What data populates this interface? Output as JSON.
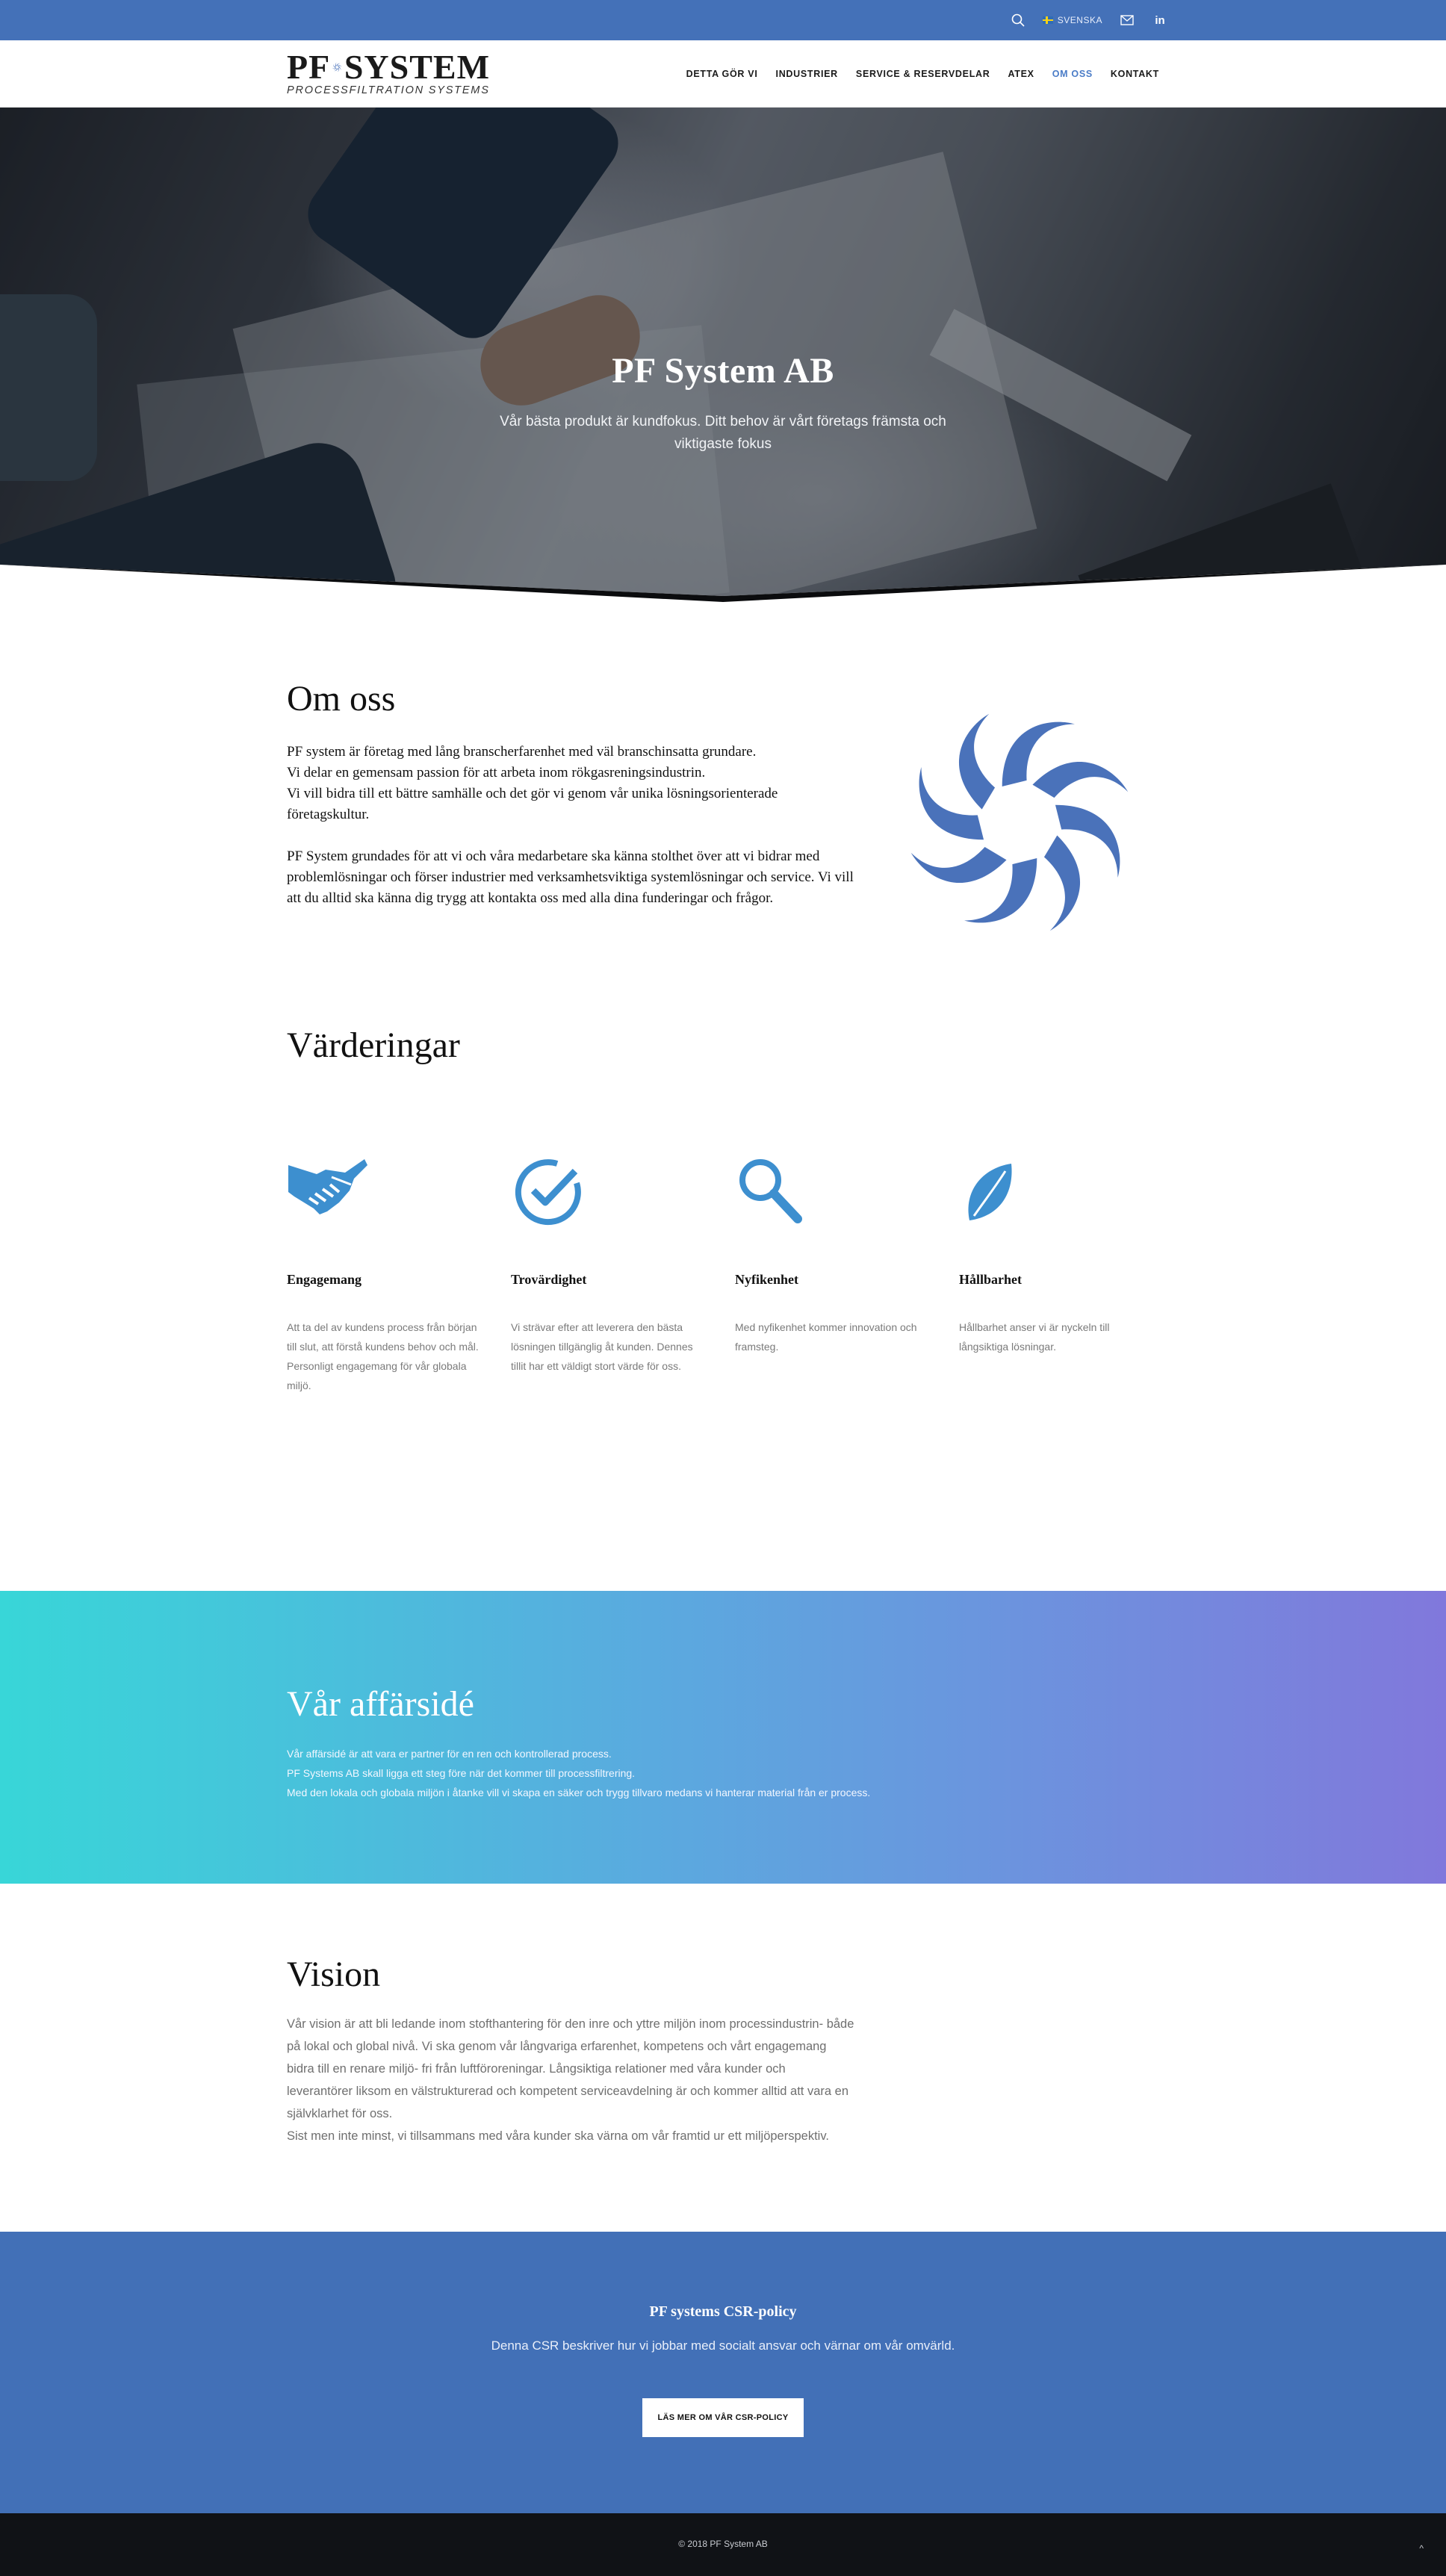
{
  "topbar": {
    "search_icon": "search-icon",
    "language_label": "SVENSKA",
    "mail_icon": "mail-icon",
    "linkedin_label": "in"
  },
  "header": {
    "logo_main_left": "PF",
    "logo_main_right": "SYSTEM",
    "logo_sub": "PROCESSFILTRATION SYSTEMS",
    "nav": [
      {
        "label": "DETTA GÖR VI"
      },
      {
        "label": "INDUSTRIER"
      },
      {
        "label": "SERVICE & RESERVDELAR"
      },
      {
        "label": "ATEX"
      },
      {
        "label": "OM OSS",
        "active": true
      },
      {
        "label": "KONTAKT"
      }
    ]
  },
  "hero": {
    "title": "PF System AB",
    "subtitle": "Vår bästa produkt är kundfokus. Ditt behov är vårt företags främsta och viktigaste fokus"
  },
  "about": {
    "heading": "Om oss",
    "paragraph1_lines": [
      "PF system är företag med lång branscherfarenhet med väl branschinsatta grundare.",
      "Vi delar en gemensam passion för att arbeta inom rökgasreningsindustrin.",
      "Vi vill bidra till ett bättre samhälle och det gör vi genom vår unika lösningsorienterade företagskultur."
    ],
    "paragraph2": "PF System grundades för att vi och våra medarbetare ska känna stolthet över att vi bidrar med problemlösningar och förser industrier med verksamhetsviktiga systemlösningar och service. Vi vill att du alltid ska känna dig trygg att kontakta oss med alla dina funderingar och frågor."
  },
  "values": {
    "heading": "Värderingar",
    "items": [
      {
        "icon": "handshake-icon",
        "title": "Engagemang",
        "text": "Att ta del av kundens process från början till slut, att förstå kundens behov och mål. Personligt engagemang för vår globala miljö."
      },
      {
        "icon": "check-circle-icon",
        "title": "Trovärdighet",
        "text": "Vi strävar efter att leverera den bästa lösningen tillgänglig åt kunden. Dennes tillit har ett väldigt stort värde för oss."
      },
      {
        "icon": "magnifier-icon",
        "title": "Nyfikenhet",
        "text": "Med nyfikenhet kommer innovation och framsteg."
      },
      {
        "icon": "leaf-icon",
        "title": "Hållbarhet",
        "text": "Hållbarhet anser vi är nyckeln till långsiktiga lösningar."
      }
    ]
  },
  "business": {
    "heading": "Vår affärsidé",
    "lines": [
      "Vår affärsidé är att vara er partner för en ren och kontrollerad process.",
      "PF Systems AB skall ligga ett steg före när det kommer till processfiltrering.",
      "Med den lokala och globala miljön i åtanke vill vi skapa en säker och trygg tillvaro medans vi hanterar material från er process."
    ]
  },
  "vision": {
    "heading": "Vision",
    "text": "Vår vision är att bli ledande inom stofthantering för den inre och yttre miljön inom processindustrin- både på lokal och global nivå. Vi ska genom vår långvariga erfarenhet, kompetens och vårt engagemang bidra till en renare miljö- fri från luftföroreningar. Långsiktiga relationer med våra kunder och leverantörer liksom en välstrukturerad och kompetent serviceavdelning är och kommer alltid att vara en självklarhet för oss.",
    "text2": "Sist men inte minst, vi tillsammans med våra kunder ska värna om vår framtid ur ett miljöperspektiv."
  },
  "csr": {
    "title": "PF systems CSR-policy",
    "text": "Denna CSR beskriver hur vi jobbar med socialt ansvar och värnar om vår omvärld.",
    "button_label": "LÄS MER OM VÅR CSR-POLICY"
  },
  "footer": {
    "copyright": "© 2018 PF System AB",
    "to_top": "^"
  },
  "colors": {
    "brand_blue": "#4471b8",
    "swirl_blue": "#4a72ba",
    "value_icon_blue": "#3d8fcf",
    "gradient_start": "#38d6d8",
    "gradient_end": "#8178dc",
    "footer_bg": "#101216"
  }
}
